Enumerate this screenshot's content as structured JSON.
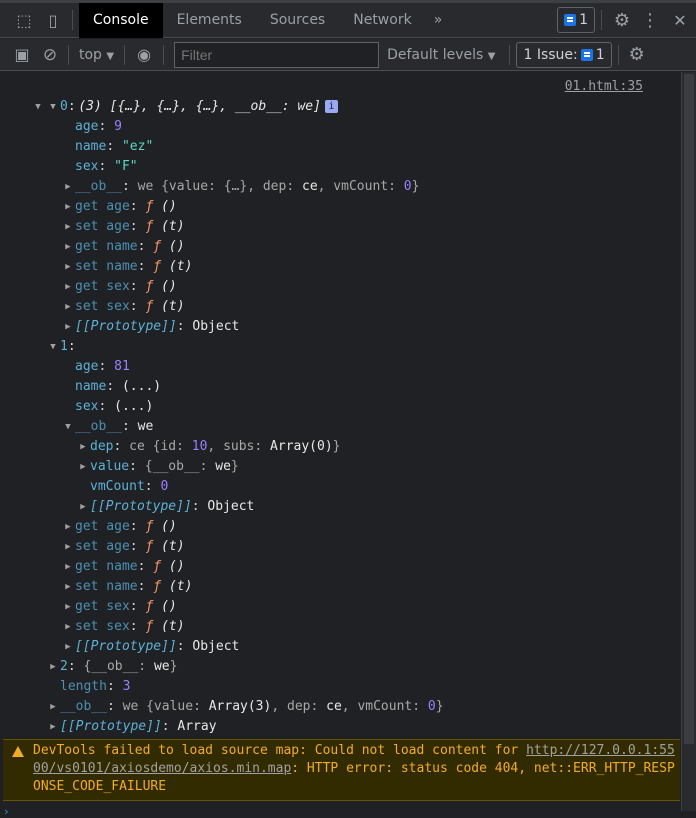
{
  "tabs": {
    "items": [
      "Console",
      "Elements",
      "Sources",
      "Network"
    ],
    "more": "»",
    "issues_count": "1"
  },
  "toolbar": {
    "context": "top",
    "filter_placeholder": "Filter",
    "levels": "Default levels",
    "issues_label": "1 Issue:",
    "issues_count": "1"
  },
  "log": {
    "summary": "(3) [{…}, {…}, {…}, __ob__: we]",
    "info_badge": "i",
    "source": "01.html:35",
    "rows": [
      {
        "lvl": 1,
        "arrow": "down",
        "segs": [
          {
            "t": "0",
            "c": "k"
          },
          {
            "t": ": ",
            "c": "p"
          }
        ]
      },
      {
        "lvl": 2,
        "arrow": "",
        "segs": [
          {
            "t": "age",
            "c": "k"
          },
          {
            "t": ": ",
            "c": "p"
          },
          {
            "t": "9",
            "c": "n"
          }
        ]
      },
      {
        "lvl": 2,
        "arrow": "",
        "segs": [
          {
            "t": "name",
            "c": "k"
          },
          {
            "t": ": ",
            "c": "p"
          },
          {
            "t": "\"ez\"",
            "c": "s"
          }
        ]
      },
      {
        "lvl": 2,
        "arrow": "",
        "segs": [
          {
            "t": "sex",
            "c": "k"
          },
          {
            "t": ": ",
            "c": "p"
          },
          {
            "t": "\"F\"",
            "c": "s"
          }
        ]
      },
      {
        "lvl": 2,
        "arrow": "right",
        "segs": [
          {
            "t": "__ob__",
            "c": "kd"
          },
          {
            "t": ": ",
            "c": "p"
          },
          {
            "t": "we {value: {…}, dep: ",
            "c": "g"
          },
          {
            "t": "ce",
            "c": "b"
          },
          {
            "t": ", vmCount: ",
            "c": "g"
          },
          {
            "t": "0",
            "c": "n"
          },
          {
            "t": "}",
            "c": "g"
          }
        ]
      },
      {
        "lvl": 2,
        "arrow": "right",
        "segs": [
          {
            "t": "get age",
            "c": "kd"
          },
          {
            "t": ": ",
            "c": "p"
          },
          {
            "t": "ƒ",
            "c": "f"
          },
          {
            "t": " ()",
            "c": "it"
          }
        ]
      },
      {
        "lvl": 2,
        "arrow": "right",
        "segs": [
          {
            "t": "set age",
            "c": "kd"
          },
          {
            "t": ": ",
            "c": "p"
          },
          {
            "t": "ƒ",
            "c": "f"
          },
          {
            "t": " (t)",
            "c": "it"
          }
        ]
      },
      {
        "lvl": 2,
        "arrow": "right",
        "segs": [
          {
            "t": "get name",
            "c": "kd"
          },
          {
            "t": ": ",
            "c": "p"
          },
          {
            "t": "ƒ",
            "c": "f"
          },
          {
            "t": " ()",
            "c": "it"
          }
        ]
      },
      {
        "lvl": 2,
        "arrow": "right",
        "segs": [
          {
            "t": "set name",
            "c": "kd"
          },
          {
            "t": ": ",
            "c": "p"
          },
          {
            "t": "ƒ",
            "c": "f"
          },
          {
            "t": " (t)",
            "c": "it"
          }
        ]
      },
      {
        "lvl": 2,
        "arrow": "right",
        "segs": [
          {
            "t": "get sex",
            "c": "kd"
          },
          {
            "t": ": ",
            "c": "p"
          },
          {
            "t": "ƒ",
            "c": "f"
          },
          {
            "t": " ()",
            "c": "it"
          }
        ]
      },
      {
        "lvl": 2,
        "arrow": "right",
        "segs": [
          {
            "t": "set sex",
            "c": "kd"
          },
          {
            "t": ": ",
            "c": "p"
          },
          {
            "t": "ƒ",
            "c": "f"
          },
          {
            "t": " (t)",
            "c": "it"
          }
        ]
      },
      {
        "lvl": 2,
        "arrow": "right",
        "segs": [
          {
            "t": "[[Prototype]]",
            "c": "pr"
          },
          {
            "t": ": ",
            "c": "p"
          },
          {
            "t": "Object",
            "c": "b"
          }
        ]
      },
      {
        "lvl": 1,
        "arrow": "down",
        "segs": [
          {
            "t": "1",
            "c": "k"
          },
          {
            "t": ": ",
            "c": "p"
          }
        ]
      },
      {
        "lvl": 2,
        "arrow": "",
        "segs": [
          {
            "t": "age",
            "c": "k"
          },
          {
            "t": ": ",
            "c": "p"
          },
          {
            "t": "81",
            "c": "n"
          }
        ]
      },
      {
        "lvl": 2,
        "arrow": "",
        "segs": [
          {
            "t": "name",
            "c": "k"
          },
          {
            "t": ": ",
            "c": "p"
          },
          {
            "t": "(...)",
            "c": "b"
          }
        ]
      },
      {
        "lvl": 2,
        "arrow": "",
        "segs": [
          {
            "t": "sex",
            "c": "k"
          },
          {
            "t": ": ",
            "c": "p"
          },
          {
            "t": "(...)",
            "c": "b"
          }
        ]
      },
      {
        "lvl": 2,
        "arrow": "down",
        "segs": [
          {
            "t": "__ob__",
            "c": "kd"
          },
          {
            "t": ": ",
            "c": "p"
          },
          {
            "t": "we",
            "c": "b"
          }
        ]
      },
      {
        "lvl": 3,
        "arrow": "right",
        "segs": [
          {
            "t": "dep",
            "c": "k"
          },
          {
            "t": ": ",
            "c": "p"
          },
          {
            "t": "ce {id: ",
            "c": "g"
          },
          {
            "t": "10",
            "c": "n"
          },
          {
            "t": ", subs: ",
            "c": "g"
          },
          {
            "t": "Array(0)",
            "c": "b"
          },
          {
            "t": "}",
            "c": "g"
          }
        ]
      },
      {
        "lvl": 3,
        "arrow": "right",
        "segs": [
          {
            "t": "value",
            "c": "k"
          },
          {
            "t": ": ",
            "c": "p"
          },
          {
            "t": "{__ob__: ",
            "c": "g"
          },
          {
            "t": "we",
            "c": "b"
          },
          {
            "t": "}",
            "c": "g"
          }
        ]
      },
      {
        "lvl": 3,
        "arrow": "",
        "segs": [
          {
            "t": "vmCount",
            "c": "k"
          },
          {
            "t": ": ",
            "c": "p"
          },
          {
            "t": "0",
            "c": "n"
          }
        ]
      },
      {
        "lvl": 3,
        "arrow": "right",
        "segs": [
          {
            "t": "[[Prototype]]",
            "c": "pr"
          },
          {
            "t": ": ",
            "c": "p"
          },
          {
            "t": "Object",
            "c": "b"
          }
        ]
      },
      {
        "lvl": 2,
        "arrow": "right",
        "segs": [
          {
            "t": "get age",
            "c": "kd"
          },
          {
            "t": ": ",
            "c": "p"
          },
          {
            "t": "ƒ",
            "c": "f"
          },
          {
            "t": " ()",
            "c": "it"
          }
        ]
      },
      {
        "lvl": 2,
        "arrow": "right",
        "segs": [
          {
            "t": "set age",
            "c": "kd"
          },
          {
            "t": ": ",
            "c": "p"
          },
          {
            "t": "ƒ",
            "c": "f"
          },
          {
            "t": " (t)",
            "c": "it"
          }
        ]
      },
      {
        "lvl": 2,
        "arrow": "right",
        "segs": [
          {
            "t": "get name",
            "c": "kd"
          },
          {
            "t": ": ",
            "c": "p"
          },
          {
            "t": "ƒ",
            "c": "f"
          },
          {
            "t": " ()",
            "c": "it"
          }
        ]
      },
      {
        "lvl": 2,
        "arrow": "right",
        "segs": [
          {
            "t": "set name",
            "c": "kd"
          },
          {
            "t": ": ",
            "c": "p"
          },
          {
            "t": "ƒ",
            "c": "f"
          },
          {
            "t": " (t)",
            "c": "it"
          }
        ]
      },
      {
        "lvl": 2,
        "arrow": "right",
        "segs": [
          {
            "t": "get sex",
            "c": "kd"
          },
          {
            "t": ": ",
            "c": "p"
          },
          {
            "t": "ƒ",
            "c": "f"
          },
          {
            "t": " ()",
            "c": "it"
          }
        ]
      },
      {
        "lvl": 2,
        "arrow": "right",
        "segs": [
          {
            "t": "set sex",
            "c": "kd"
          },
          {
            "t": ": ",
            "c": "p"
          },
          {
            "t": "ƒ",
            "c": "f"
          },
          {
            "t": " (t)",
            "c": "it"
          }
        ]
      },
      {
        "lvl": 2,
        "arrow": "right",
        "segs": [
          {
            "t": "[[Prototype]]",
            "c": "pr"
          },
          {
            "t": ": ",
            "c": "p"
          },
          {
            "t": "Object",
            "c": "b"
          }
        ]
      },
      {
        "lvl": 1,
        "arrow": "right",
        "segs": [
          {
            "t": "2",
            "c": "k"
          },
          {
            "t": ": ",
            "c": "p"
          },
          {
            "t": "{__ob__: ",
            "c": "g"
          },
          {
            "t": "we",
            "c": "b"
          },
          {
            "t": "}",
            "c": "g"
          }
        ]
      },
      {
        "lvl": 1,
        "arrow": "",
        "segs": [
          {
            "t": "length",
            "c": "kd"
          },
          {
            "t": ": ",
            "c": "p"
          },
          {
            "t": "3",
            "c": "n"
          }
        ]
      },
      {
        "lvl": 1,
        "arrow": "right",
        "segs": [
          {
            "t": "__ob__",
            "c": "kd"
          },
          {
            "t": ": ",
            "c": "p"
          },
          {
            "t": "we {value: ",
            "c": "g"
          },
          {
            "t": "Array(3)",
            "c": "b"
          },
          {
            "t": ", dep: ",
            "c": "g"
          },
          {
            "t": "ce",
            "c": "b"
          },
          {
            "t": ", vmCount: ",
            "c": "g"
          },
          {
            "t": "0",
            "c": "n"
          },
          {
            "t": "}",
            "c": "g"
          }
        ]
      },
      {
        "lvl": 1,
        "arrow": "right",
        "segs": [
          {
            "t": "[[Prototype]]",
            "c": "pr"
          },
          {
            "t": ": ",
            "c": "p"
          },
          {
            "t": "Array",
            "c": "b"
          }
        ]
      }
    ]
  },
  "warning": {
    "text1": "DevTools failed to load source map: Could not load content for ",
    "link": "http://127.0.0.1:5500/vs0101/axiosdemo/axios.min.map",
    "text2": ": HTTP error: status code 404, net::ERR_HTTP_RESPONSE_CODE_FAILURE"
  },
  "colors": {
    "key": "#5db0d7",
    "number": "#9980ff",
    "string": "#5cd5c5",
    "function": "#f29766",
    "warning_bg": "#332b00",
    "warning_text": "#f2ab26"
  }
}
